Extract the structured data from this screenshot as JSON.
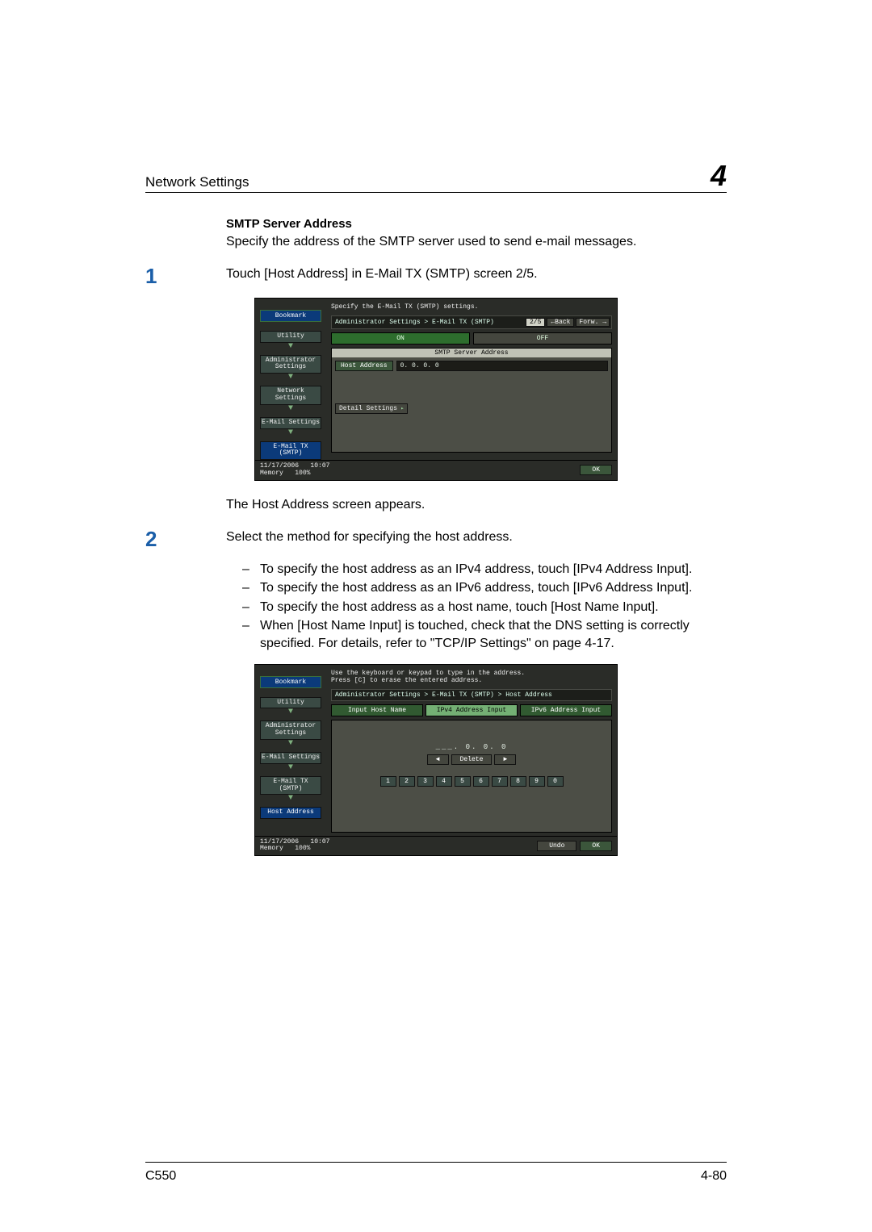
{
  "page": {
    "header_title": "Network Settings",
    "chapter_number": "4",
    "footer_left": "C550",
    "footer_right": "4-80"
  },
  "section": {
    "title": "SMTP Server Address",
    "intro": "Specify the address of the SMTP server used to send e-mail messages."
  },
  "steps": {
    "s1_num": "1",
    "s1_text": "Touch [Host Address] in E-Mail TX (SMTP) screen 2/5.",
    "s1_after": "The Host Address screen appears.",
    "s2_num": "2",
    "s2_text": "Select the method for specifying the host address.",
    "bullets": [
      "To specify the host address as an IPv4 address, touch [IPv4 Address Input].",
      "To specify the host address as an IPv6 address, touch [IPv6 Address Input].",
      "To specify the host address as a host name, touch [Host Name Input].",
      "When [Host Name Input] is touched, check that the DNS setting is correctly specified. For details, refer to \"TCP/IP Settings\" on page 4-17."
    ]
  },
  "screen1": {
    "instr": "Specify the E-Mail TX (SMTP) settings.",
    "bookmark": "Bookmark",
    "nav": [
      "Utility",
      "Administrator Settings",
      "Network Settings",
      "E-Mail Settings",
      "E-Mail TX (SMTP)"
    ],
    "crumb": "Administrator Settings > E-Mail TX (SMTP)",
    "page_ind": "2/5",
    "back": "←Back",
    "fwd_label": "Forw. →",
    "on": "ON",
    "off": "OFF",
    "panel_title": "SMTP Server Address",
    "host_btn": "Host Address",
    "host_val": "0. 0. 0. 0",
    "detail_btn": "Detail Settings",
    "date": "11/17/2006",
    "time": "10:07",
    "mem_label": "Memory",
    "mem_val": "100%",
    "ok": "OK"
  },
  "screen2": {
    "instr": "Use the keyboard or keypad to type in the address.\nPress [C] to erase the entered address.",
    "bookmark": "Bookmark",
    "nav": [
      "Utility",
      "Administrator Settings",
      "E-Mail Settings",
      "E-Mail TX (SMTP)",
      "Host Address"
    ],
    "crumb": "Administrator Settings > E-Mail TX (SMTP) > Host Address",
    "tabs": {
      "name": "Input Host Name",
      "v4": "IPv4 Address Input",
      "v6": "IPv6 Address Input"
    },
    "ip_display": "___. 0. 0. 0",
    "left_arrow": "◄",
    "delete": "Delete",
    "right_arrow": "►",
    "keys": [
      "1",
      "2",
      "3",
      "4",
      "5",
      "6",
      "7",
      "8",
      "9",
      "0"
    ],
    "date": "11/17/2006",
    "time": "10:07",
    "mem_label": "Memory",
    "mem_val": "100%",
    "undo": "Undo",
    "ok": "OK"
  }
}
